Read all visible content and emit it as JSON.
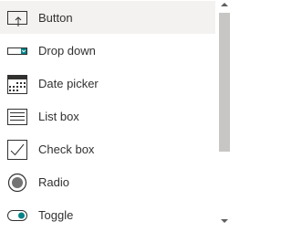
{
  "items": [
    {
      "label": "Button",
      "icon": "button-icon",
      "selected": true
    },
    {
      "label": "Drop down",
      "icon": "dropdown-icon",
      "selected": false
    },
    {
      "label": "Date picker",
      "icon": "date-picker-icon",
      "selected": false
    },
    {
      "label": "List box",
      "icon": "list-box-icon",
      "selected": false
    },
    {
      "label": "Check box",
      "icon": "check-box-icon",
      "selected": false
    },
    {
      "label": "Radio",
      "icon": "radio-icon",
      "selected": false
    },
    {
      "label": "Toggle",
      "icon": "toggle-icon",
      "selected": false
    }
  ],
  "colors": {
    "text": "#323130",
    "selected_bg": "#f3f2f1",
    "accent": "#038387",
    "scroll_thumb": "#c8c6c4"
  }
}
